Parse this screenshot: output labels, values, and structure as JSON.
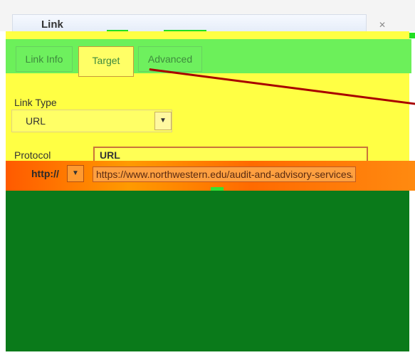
{
  "dialog": {
    "title": "Link",
    "close_label": "✕"
  },
  "tabs": [
    {
      "label": "Link Info"
    },
    {
      "label": "Target"
    },
    {
      "label": "Advanced"
    }
  ],
  "link_type": {
    "label": "Link Type",
    "value": "URL"
  },
  "protocol": {
    "label": "Protocol",
    "value": "http://"
  },
  "url": {
    "label": "URL",
    "value": "https://www.northwestern.edu/audit-and-advisory-services/"
  },
  "icons": {
    "close": "close-icon",
    "dropdown": "chevron-down-icon"
  },
  "colors": {
    "body": "#ffff44",
    "tabstrip": "#6cf05a",
    "arrow": "#a80000",
    "band": "#ff7a00",
    "panel": "#0a7a1a"
  }
}
